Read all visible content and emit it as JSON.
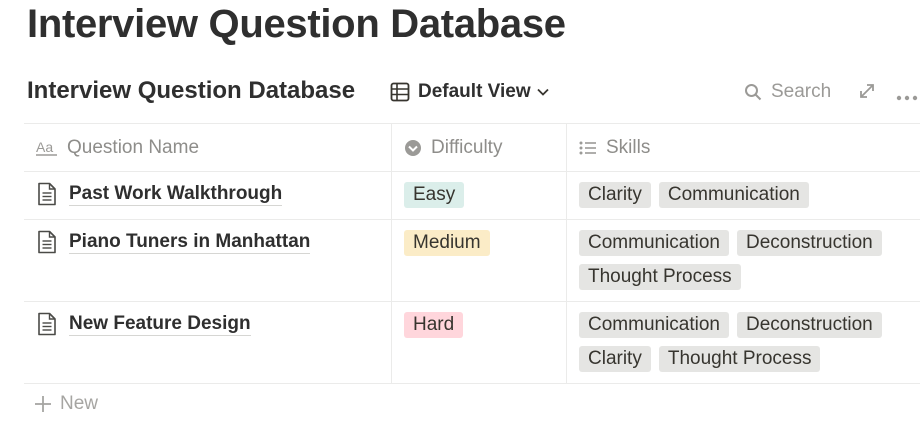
{
  "page": {
    "title": "Interview Question Database"
  },
  "database": {
    "title": "Interview Question Database",
    "view_label": "Default View",
    "search_label": "Search"
  },
  "columns": [
    {
      "label": "Question Name",
      "icon": "text-property-icon"
    },
    {
      "label": "Difficulty",
      "icon": "select-property-icon"
    },
    {
      "label": "Skills",
      "icon": "multi-select-property-icon"
    }
  ],
  "rows": [
    {
      "name": "Past Work Walkthrough",
      "difficulty": "Easy",
      "skills": [
        "Clarity",
        "Communication"
      ]
    },
    {
      "name": "Piano Tuners in Manhattan",
      "difficulty": "Medium",
      "skills": [
        "Communication",
        "Deconstruction",
        "Thought Process"
      ]
    },
    {
      "name": "New Feature Design",
      "difficulty": "Hard",
      "skills": [
        "Communication",
        "Deconstruction",
        "Clarity",
        "Thought Process"
      ]
    }
  ],
  "difficulty_colors": {
    "Easy": "#dbeeea",
    "Medium": "#fbecc7",
    "Hard": "#ffd6dc"
  },
  "new_row_label": "New"
}
